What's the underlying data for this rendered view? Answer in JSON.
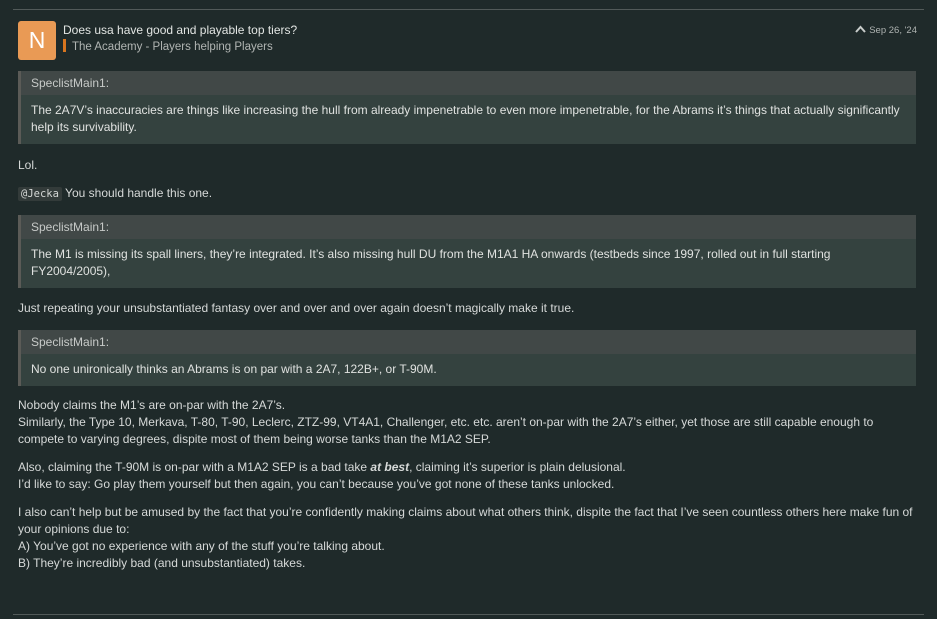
{
  "post": {
    "avatar_letter": "N",
    "title": "Does usa have good and playable top tiers?",
    "category": "The Academy - Players helping Players",
    "date": "Sep 26, '24",
    "chevron": "^"
  },
  "quotes": [
    {
      "author": "SpeclistMain1:",
      "text": "The 2A7V’s inaccuracies are things like increasing the hull from already impenetrable to even more impenetrable, for the Abrams it’s things that actually significantly help its survivability."
    },
    {
      "author": "SpeclistMain1:",
      "text": "The M1 is missing its spall liners, they’re integrated. It’s also missing hull DU from the M1A1 HA onwards (testbeds since 1997, rolled out in full starting FY2004/2005),"
    },
    {
      "author": "SpeclistMain1:",
      "text": "No one unironically thinks an Abrams is on par with a 2A7, 122B+, or T-90M."
    }
  ],
  "body": {
    "lol": "Lol.",
    "mention": "@Jecka",
    "mention_text": " You should handle this one.",
    "repeat": "Just repeating your unsubstantiated fantasy over and over and over again doesn’t magically make it true.",
    "p1_line1": "Nobody claims the M1’s are on-par with the 2A7’s.",
    "p1_line2": "Similarly, the Type 10, Merkava, T-80, T-90, Leclerc, ZTZ-99, VT4A1, Challenger, etc. etc. aren’t on-par with the 2A7’s either, yet those are still capable enough to compete to varying degrees, dispite most of them being worse tanks than the M1A2 SEP.",
    "p2_pre": "Also, claiming the T-90M is on-par with a M1A2 SEP is a bad take ",
    "p2_em": "at best",
    "p2_post": ", claiming it’s superior is plain delusional.",
    "p2_line2": "I’d like to say: Go play them yourself but then again, you can’t because you’ve got none of these tanks unlocked.",
    "p3_line1": "I also can’t help but be amused by the fact that you’re confidently making claims about what others think, dispite the fact that I’ve seen countless others here make fun of your opinions due to:",
    "p3_line2": "A) You’ve got no experience with any of the stuff you’re talking about.",
    "p3_line3": "B) They’re incredibly bad (and unsubstantiated) takes."
  }
}
